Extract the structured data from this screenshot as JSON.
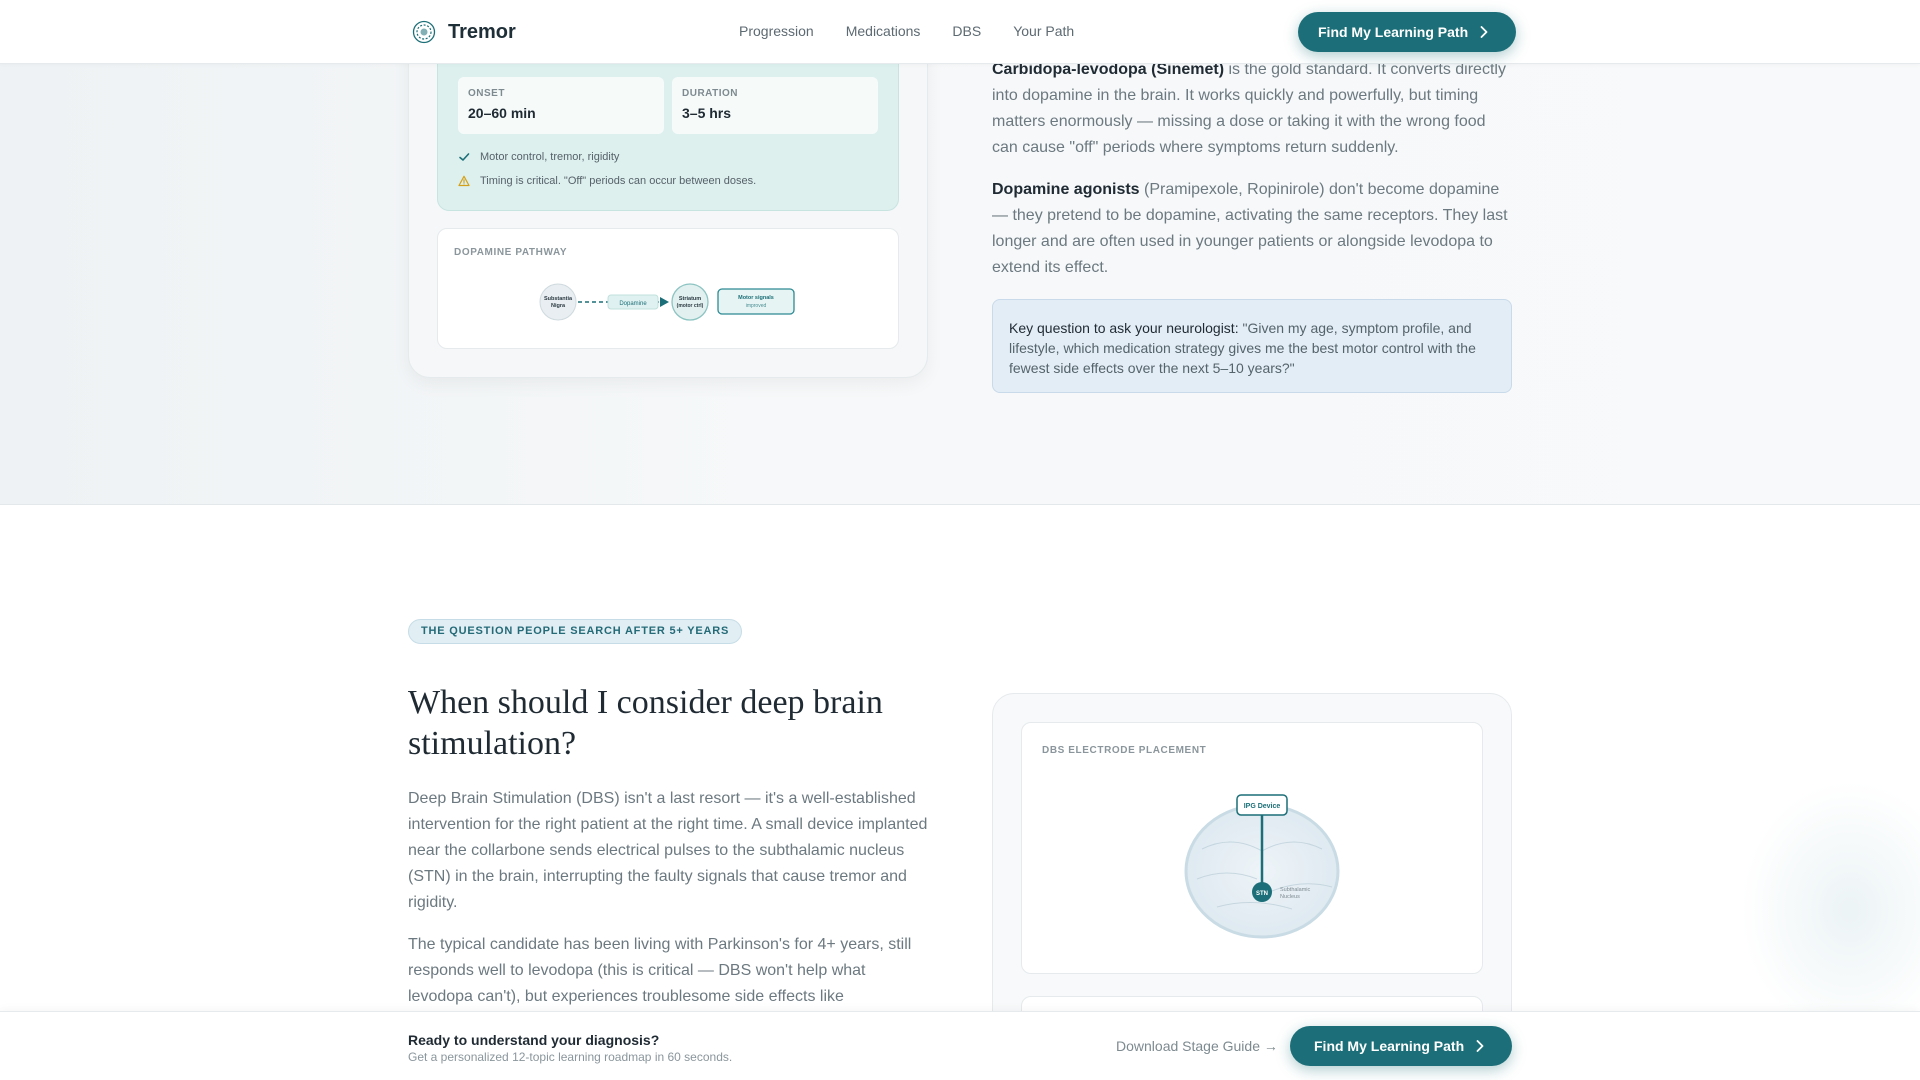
{
  "nav": {
    "brand": "Tremor",
    "links": [
      "Progression",
      "Medications",
      "DBS",
      "Your Path"
    ],
    "cta": "Find My Learning Path"
  },
  "medication_card": {
    "stats": [
      {
        "label": "ONSET",
        "value": "20–60 min"
      },
      {
        "label": "DURATION",
        "value": "3–5 hrs"
      }
    ],
    "bullets": [
      {
        "icon": "check-icon",
        "text": "Motor control, tremor, rigidity"
      },
      {
        "icon": "warning-icon",
        "text": "Timing is critical. \"Off\" periods can occur between doses."
      }
    ],
    "pathway": {
      "label": "DOPAMINE PATHWAY",
      "nodes": [
        "Substantia Nigra",
        "Striatum (motor ctrl)"
      ],
      "mid_label": "Dopamine",
      "end_box": "Motor signals",
      "end_sub": "improved"
    }
  },
  "medication_text": {
    "p1_bold": "Carbidopa-levodopa (Sinemet)",
    "p1_rest": " is the gold standard. It converts directly into dopamine in the brain. It works quickly and powerfully, but timing matters enormously — missing a dose or taking it with the wrong food can cause \"off\" periods where symptoms return suddenly.",
    "p2_bold": "Dopamine agonists",
    "p2_rest": " (Pramipexole, Ropinirole) don't become dopamine — they pretend to be dopamine, activating the same receptors. They last longer and are often used in younger patients or alongside levodopa to extend its effect.",
    "key_bold": "Key question to ask your neurologist:",
    "key_rest": " \"Given my age, symptom profile, and lifestyle, which medication strategy gives me the best motor control with the fewest side effects over the next 5–10 years?\""
  },
  "dbs": {
    "pill": "THE QUESTION PEOPLE SEARCH AFTER 5+ YEARS",
    "title": "When should I consider deep brain stimulation?",
    "p1": "Deep Brain Stimulation (DBS) isn't a last resort — it's a well-established intervention for the right patient at the right time. A small device implanted near the collarbone sends electrical pulses to the subthalamic nucleus (STN) in the brain, interrupting the faulty signals that cause tremor and rigidity.",
    "p2": "The typical candidate has been living with Parkinson's for 4+ years, still responds well to levodopa (this is critical — DBS won't help what levodopa can't), but experiences troublesome side effects like",
    "diagram": {
      "label": "DBS ELECTRODE PLACEMENT",
      "device": "IPG Device",
      "target": "STN",
      "target_label": "Subthalamic Nucleus"
    }
  },
  "bottom_bar": {
    "title": "Ready to understand your diagnosis?",
    "subtitle": "Get a personalized 12-topic learning roadmap in 60 seconds.",
    "download": "Download Stage Guide →",
    "cta": "Find My Learning Path"
  },
  "colors": {
    "primary": "#1c6f78",
    "mint": "#ddf0ee",
    "key_box": "#e3edf6"
  }
}
